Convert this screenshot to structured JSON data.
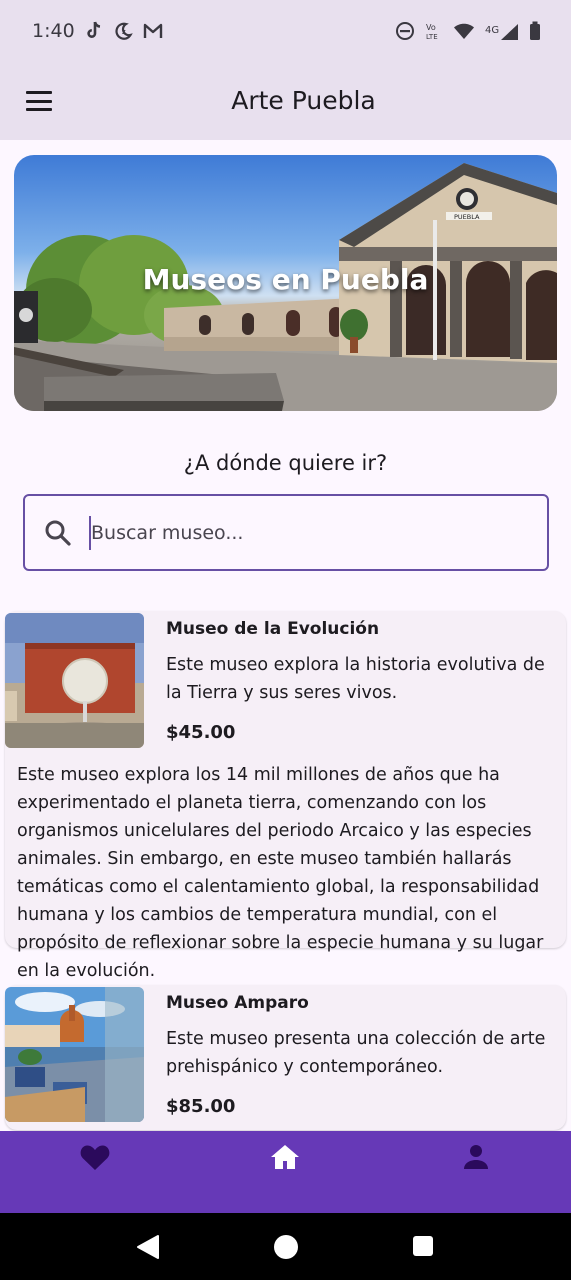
{
  "status_bar": {
    "time": "1:40",
    "left_icons": [
      "tiktok-icon",
      "moon-icon",
      "gmail-icon"
    ],
    "right_icons": [
      "dnd-icon",
      "volte-icon",
      "wifi-icon",
      "4g-signal-icon",
      "battery-icon"
    ],
    "volte_label": "Vo LTE",
    "network_label": "4G"
  },
  "app_bar": {
    "title": "Arte Puebla"
  },
  "hero": {
    "title": "Museos en Puebla",
    "station_sign": "PUEBLA"
  },
  "search": {
    "question": "¿A dónde quiere ir?",
    "placeholder": "Buscar museo...",
    "value": ""
  },
  "museums": [
    {
      "name": "Museo de la Evolución",
      "short_description": "Este museo explora la historia evolutiva de la Tierra y sus seres vivos.",
      "price": "$45.00",
      "long_description": "Este museo explora los 14 mil millones de años que ha experimentado el planeta tierra, comenzando con los organismos unicelulares del periodo Arcaico y las especies animales. Sin embargo, en este museo también hallarás temáticas como el calentamiento global, la responsabilidad humana y los cambios de temperatura mundial, con el propósito de reflexionar sobre la especie humana y su lugar en la evolución."
    },
    {
      "name": "Museo Amparo",
      "short_description": "Este museo presenta una colección de arte prehispánico y contemporáneo.",
      "price": "$85.00"
    }
  ],
  "bottom_nav": {
    "items": [
      "favorites-icon",
      "home-icon",
      "profile-icon"
    ],
    "color": "#6639b7"
  },
  "colors": {
    "primary": "#6750a4",
    "app_bar_bg": "#e8e0ee",
    "background": "#fdf7ff"
  }
}
